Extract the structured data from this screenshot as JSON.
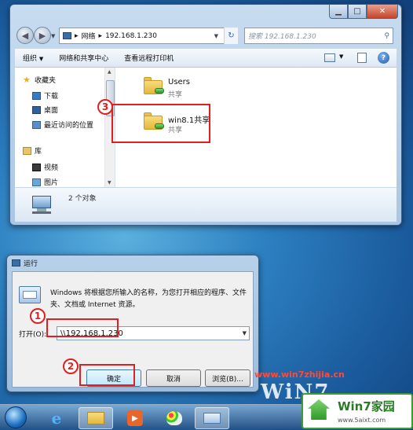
{
  "explorer": {
    "address_parts": [
      "网络",
      "192.168.1.230"
    ],
    "search_placeholder": "搜索 192.168.1.230",
    "toolbar": {
      "organize": "组织",
      "network_center": "网络和共享中心",
      "remote_printers": "查看远程打印机"
    },
    "nav": {
      "favorites": "收藏夹",
      "downloads": "下载",
      "desktop": "桌面",
      "recent": "最近访问的位置",
      "libraries": "库",
      "videos": "视频",
      "pictures": "图片"
    },
    "items": [
      {
        "name": "Users",
        "type": "共享"
      },
      {
        "name": "win8.1共享",
        "type": "共享"
      }
    ],
    "status": "2 个对象"
  },
  "run": {
    "title": "运行",
    "description": "Windows 将根据您所输入的名称，为您打开相应的程序、文件夹、文档或 Internet 资源。",
    "open_label": "打开(O):",
    "open_value": "\\\\192.168.1.230",
    "ok": "确定",
    "cancel": "取消",
    "browse": "浏览(B)..."
  },
  "annotations": {
    "step1": "1",
    "step2": "2",
    "step3": "3"
  },
  "watermark": {
    "url": "www.win7zhijia.cn",
    "logo": "WiN7",
    "badge": "Win7家园",
    "badge_url": "www.5aixt.com"
  },
  "colors": {
    "highlight": "#e02020",
    "accent": "#2c7fc0"
  }
}
